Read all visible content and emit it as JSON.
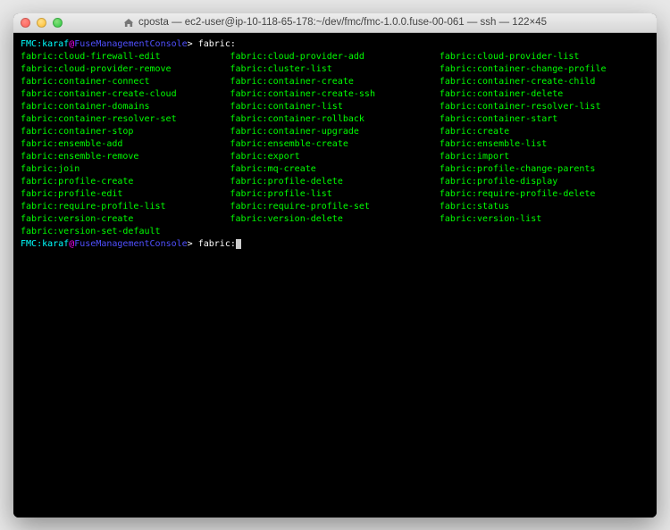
{
  "window": {
    "title": "cposta — ec2-user@ip-10-118-65-178:~/dev/fmc/fmc-1.0.0.fuse-00-061 — ssh — 122×45"
  },
  "prompt": {
    "fmc": "FMC",
    "sep1": ":",
    "user": "karaf",
    "at": "@",
    "host": "FuseManagementConsole",
    "gt": "> ",
    "input": "fabric:"
  },
  "commands": {
    "col1": [
      "fabric:cloud-firewall-edit",
      "fabric:cloud-provider-remove",
      "fabric:container-connect",
      "fabric:container-create-cloud",
      "fabric:container-domains",
      "fabric:container-resolver-set",
      "fabric:container-stop",
      "fabric:ensemble-add",
      "fabric:ensemble-remove",
      "fabric:join",
      "fabric:profile-create",
      "fabric:profile-edit",
      "fabric:require-profile-list",
      "fabric:version-create",
      "fabric:version-set-default"
    ],
    "col2": [
      "fabric:cloud-provider-add",
      "fabric:cluster-list",
      "fabric:container-create",
      "fabric:container-create-ssh",
      "fabric:container-list",
      "fabric:container-rollback",
      "fabric:container-upgrade",
      "fabric:ensemble-create",
      "fabric:export",
      "fabric:mq-create",
      "fabric:profile-delete",
      "fabric:profile-list",
      "fabric:require-profile-set",
      "fabric:version-delete"
    ],
    "col3": [
      "fabric:cloud-provider-list",
      "fabric:container-change-profile",
      "fabric:container-create-child",
      "fabric:container-delete",
      "fabric:container-resolver-list",
      "fabric:container-start",
      "fabric:create",
      "fabric:ensemble-list",
      "fabric:import",
      "fabric:profile-change-parents",
      "fabric:profile-display",
      "fabric:require-profile-delete",
      "fabric:status",
      "fabric:version-list"
    ]
  }
}
